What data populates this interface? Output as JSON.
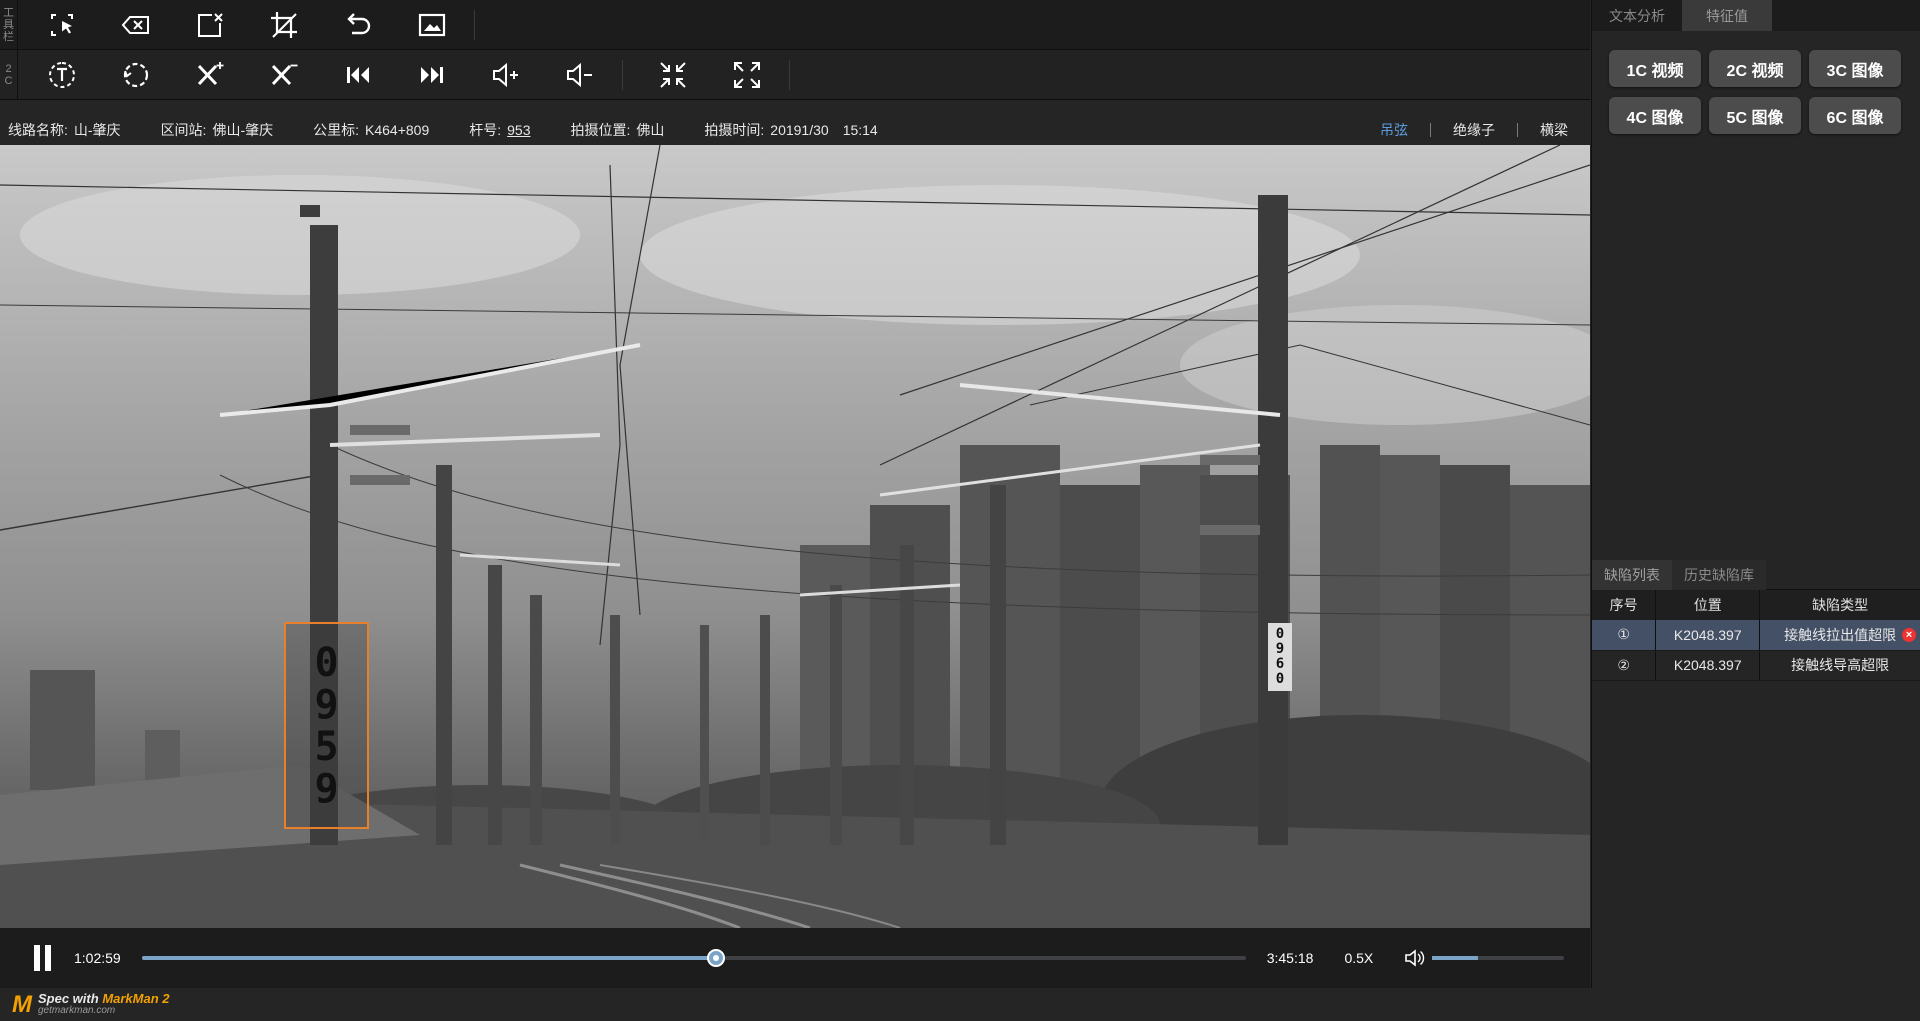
{
  "toolbar": {
    "side_label": [
      "工",
      "具",
      "栏"
    ],
    "side_label_2": [
      "2",
      "C"
    ],
    "row1_buttons": [
      "select-area",
      "backspace",
      "clear-selection",
      "crop-off",
      "undo",
      "image"
    ],
    "row2_buttons": [
      "text-tool",
      "lasso-tool",
      "add-defect",
      "remove-defect",
      "previous-frame",
      "next-frame",
      "volume-up",
      "volume-down",
      "shrink",
      "expand"
    ]
  },
  "info": {
    "line_label": "线路名称:",
    "line_value": "山-肇庆",
    "section_label": "区间站:",
    "section_value": "佛山-肇庆",
    "km_label": "公里标:",
    "km_value": "K464+809",
    "pole_label": "杆号:",
    "pole_value": "953",
    "place_label": "拍摄位置:",
    "place_value": "佛山",
    "time_label": "拍摄时间:",
    "time_date": "20191/30",
    "time_clock": "15:14",
    "links": [
      "吊弦",
      "绝缘子",
      "横梁"
    ]
  },
  "video": {
    "pole_number_left": [
      "0",
      "9",
      "5",
      "9"
    ],
    "pole_number_right": [
      "0",
      "9",
      "6",
      "0"
    ]
  },
  "playbar": {
    "current_time": "1:02:59",
    "total_time": "3:45:18",
    "progress": 0.52,
    "speed": "0.5X",
    "volume": 0.35,
    "colors": {
      "played": "#7ca4c8",
      "track": "#3e4044"
    }
  },
  "right_panel": {
    "feature_tabs": [
      "文本分析",
      "特征值"
    ],
    "camera_buttons": [
      "1C 视频",
      "2C 视频",
      "3C 图像",
      "4C 图像",
      "5C 图像",
      "6C 图像"
    ],
    "defect_tabs": [
      "缺陷列表",
      "历史缺陷库"
    ],
    "table": {
      "headers": [
        "序号",
        "位置",
        "缺陷类型"
      ],
      "rows": [
        {
          "no": "①",
          "position": "K2048.397",
          "type": "接触线拉出值超限",
          "selected": true
        },
        {
          "no": "②",
          "position": "K2048.397",
          "type": "接触线导高超限",
          "selected": false
        }
      ]
    },
    "colors": {
      "selected_row": "#445065",
      "button": "#4c4c4c"
    }
  },
  "footer": {
    "logo": "M",
    "spec_with": "Spec with",
    "brand": "MarkMan 2",
    "site": "getmarkman.com"
  }
}
